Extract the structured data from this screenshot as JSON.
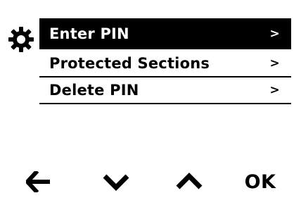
{
  "header": {
    "icon": "gear-icon"
  },
  "menu": {
    "items": [
      {
        "label": "Enter PIN",
        "chevron": ">",
        "selected": true
      },
      {
        "label": "Protected Sections",
        "chevron": ">",
        "selected": false
      },
      {
        "label": "Delete PIN",
        "chevron": ">",
        "selected": false
      }
    ]
  },
  "softkeys": {
    "back_icon": "arrow-left-icon",
    "down_icon": "chevron-down-icon",
    "up_icon": "chevron-up-icon",
    "ok_label": "OK"
  },
  "colors": {
    "background": "#ffffff",
    "foreground": "#000000",
    "selected_bg": "#000000",
    "selected_fg": "#ffffff"
  }
}
